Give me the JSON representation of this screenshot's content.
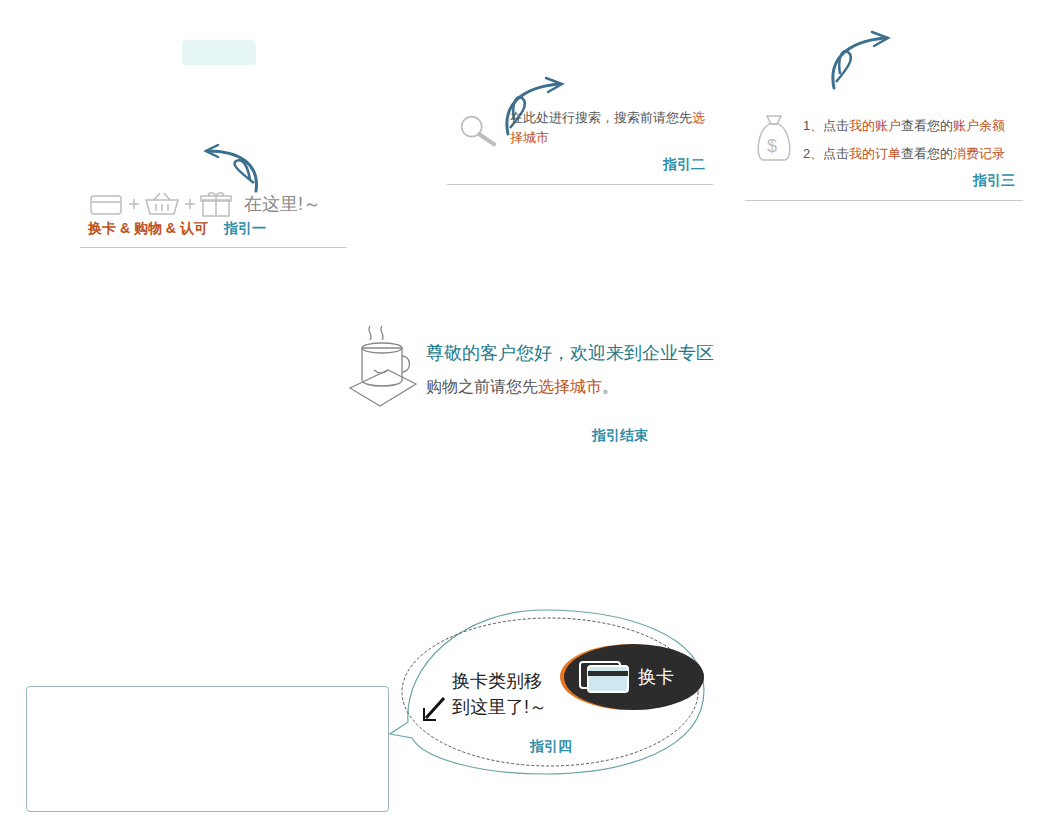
{
  "guide1": {
    "icons_tail": "在这里!～",
    "items": "换卡 & 购物 & 认可",
    "label": "指引一"
  },
  "guide2": {
    "segments": [
      {
        "text": "在此处进行搜索，搜索前请您先",
        "highlight": false
      },
      {
        "text": "选择城市",
        "highlight": true
      }
    ],
    "label": "指引二"
  },
  "guide3": {
    "lines": [
      [
        {
          "text": "1、点击",
          "highlight": false
        },
        {
          "text": "我的账户",
          "highlight": true
        },
        {
          "text": "查看您的",
          "highlight": false
        },
        {
          "text": "账户余额",
          "highlight": true
        }
      ],
      [
        {
          "text": "2、点击",
          "highlight": false
        },
        {
          "text": "我的订单",
          "highlight": true
        },
        {
          "text": "查看您的",
          "highlight": false
        },
        {
          "text": "消费记录",
          "highlight": true
        }
      ]
    ],
    "label": "指引三"
  },
  "welcome": {
    "title": "尊敬的客户您好，欢迎来到企业专区",
    "segments": [
      {
        "text": "购物之前请您先",
        "highlight": false
      },
      {
        "text": "选择城市",
        "highlight": true
      },
      {
        "text": "。",
        "highlight": false
      }
    ],
    "end": "指引结束"
  },
  "guide4": {
    "lines": [
      "换卡类别移",
      "到这里了!～"
    ],
    "button": "换卡",
    "label": "指引四"
  }
}
